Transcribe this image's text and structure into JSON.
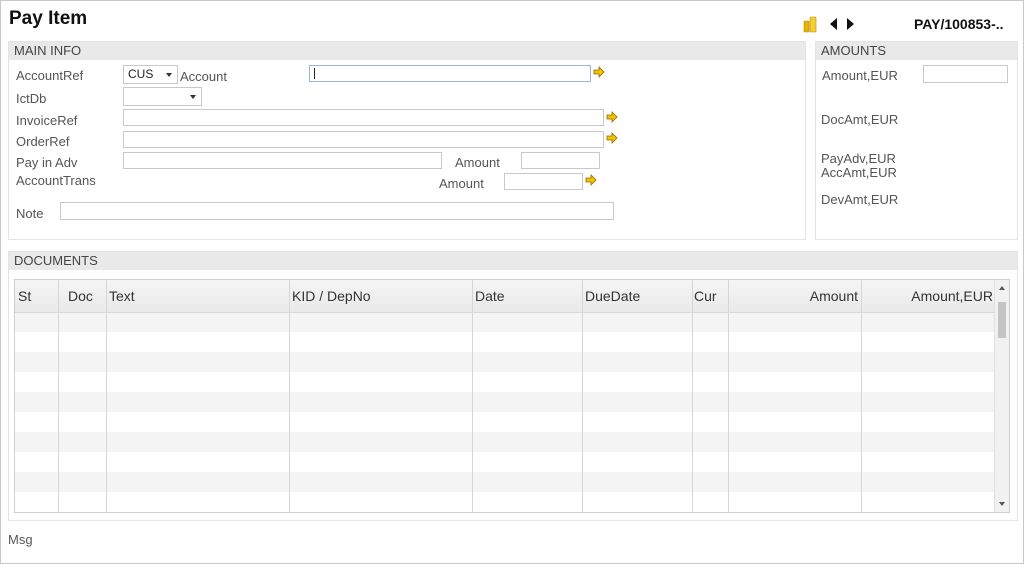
{
  "title": "Pay Item",
  "nav": {
    "ref": "PAY/100853-.."
  },
  "main_info": {
    "header": "MAIN INFO",
    "account_ref_label": "AccountRef",
    "account_ref_value": "CUS",
    "account_label": "Account",
    "ictdb_label": "IctDb",
    "invoice_ref_label": "InvoiceRef",
    "order_ref_label": "OrderRef",
    "pay_in_adv_label": "Pay in Adv",
    "amount_label": "Amount",
    "account_trans_label": "AccountTrans",
    "amount2_label": "Amount",
    "note_label": "Note"
  },
  "amounts": {
    "header": "AMOUNTS",
    "amount_eur": "Amount,EUR",
    "docamt_eur": "DocAmt,EUR",
    "payadv_eur": "PayAdv,EUR",
    "accamt_eur": "AccAmt,EUR",
    "devamt_eur": "DevAmt,EUR"
  },
  "documents": {
    "header": "DOCUMENTS",
    "columns": [
      "St",
      "Doc",
      "Text",
      "KID / DepNo",
      "Date",
      "DueDate",
      "Cur",
      "Amount",
      "Amount,EUR"
    ]
  },
  "status": {
    "msg": "Msg"
  },
  "colors": {
    "arrow": "#f2c200",
    "panel_head": "#e9e9e9"
  }
}
